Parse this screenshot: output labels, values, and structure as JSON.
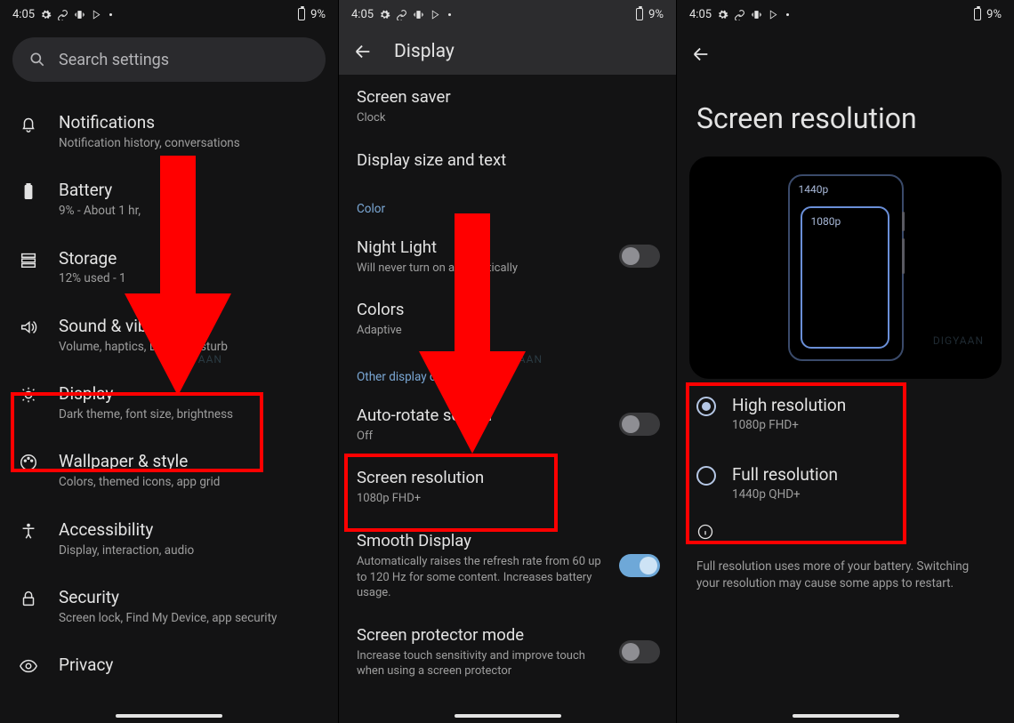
{
  "status": {
    "time": "4:05",
    "battery": "9%"
  },
  "panel1": {
    "search_placeholder": "Search settings",
    "items": [
      {
        "title": "Notifications",
        "sub": "Notification history, conversations"
      },
      {
        "title": "Battery",
        "sub": "9% - About 1 hr,"
      },
      {
        "title": "Storage",
        "sub": "12% used - 1"
      },
      {
        "title": "Sound & vibration",
        "sub": "Volume, haptics, Do Not Disturb"
      },
      {
        "title": "Display",
        "sub": "Dark theme, font size, brightness"
      },
      {
        "title": "Wallpaper & style",
        "sub": "Colors, themed icons, app grid"
      },
      {
        "title": "Accessibility",
        "sub": "Display, interaction, audio"
      },
      {
        "title": "Security",
        "sub": "Screen lock, Find My Device, app security"
      },
      {
        "title": "Privacy",
        "sub": ""
      }
    ]
  },
  "panel2": {
    "appbar_title": "Display",
    "items": {
      "screen_saver": {
        "title": "Screen saver",
        "sub": "Clock"
      },
      "display_size": {
        "title": "Display size and text"
      },
      "section_color": "Color",
      "night_light": {
        "title": "Night Light",
        "sub": "Will never turn on automatically"
      },
      "colors": {
        "title": "Colors",
        "sub": "Adaptive"
      },
      "section_other": "Other display controls",
      "auto_rotate": {
        "title": "Auto-rotate screen",
        "sub": "Off"
      },
      "screen_res": {
        "title": "Screen resolution",
        "sub": "1080p FHD+"
      },
      "smooth": {
        "title": "Smooth Display",
        "sub": "Automatically raises the refresh rate from 60 up to 120 Hz for some content. Increases battery usage."
      },
      "protector": {
        "title": "Screen protector mode",
        "sub": "Increase touch sensitivity and improve touch when using a screen protector"
      }
    }
  },
  "panel3": {
    "page_title": "Screen resolution",
    "label_1440": "1440p",
    "label_1080": "1080p",
    "options": [
      {
        "title": "High resolution",
        "sub": "1080p FHD+"
      },
      {
        "title": "Full resolution",
        "sub": "1440p QHD+"
      }
    ],
    "footnote": "Full resolution uses more of your battery. Switching your resolution may cause some apps to restart."
  }
}
